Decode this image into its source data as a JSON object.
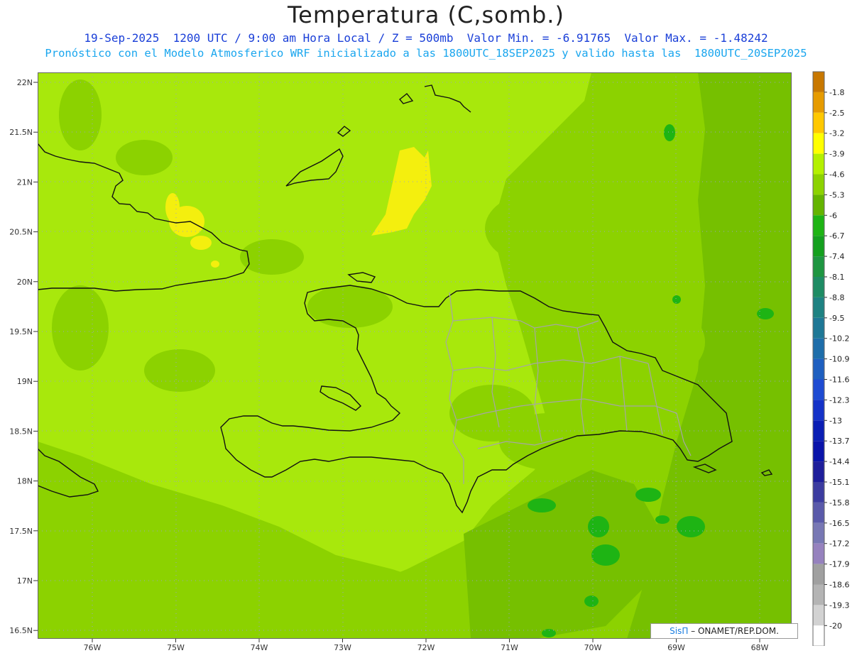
{
  "header": {
    "title": "Temperatura (C,somb.)",
    "line1": "19-Sep-2025  1200 UTC / 9:00 am Hora Local / Z = 500mb  Valor Min. = -6.91765  Valor Max. = -1.48242",
    "line2": "Pronóstico con el Modelo Atmosferico WRF inicializado a las 1800UTC_18SEP2025 y valido hasta las  1800UTC_20SEP2025"
  },
  "map": {
    "lat_labels": [
      "22N",
      "21.5N",
      "21N",
      "20.5N",
      "20N",
      "19.5N",
      "19N",
      "18.5N",
      "18N",
      "17.5N",
      "17N",
      "16.5N"
    ],
    "lon_labels": [
      "76W",
      "75W",
      "74W",
      "73W",
      "72W",
      "71W",
      "70W",
      "69W",
      "68W"
    ],
    "grid": true
  },
  "colorbar": {
    "labels": [
      "-1.8",
      "-2.5",
      "-3.2",
      "-3.9",
      "-4.6",
      "-5.3",
      "-6",
      "-6.7",
      "-7.4",
      "-8.1",
      "-8.8",
      "-9.5",
      "-10.2",
      "-10.9",
      "-11.6",
      "-12.3",
      "-13",
      "-13.7",
      "-14.4",
      "-15.1",
      "-15.8",
      "-16.5",
      "-17.2",
      "-17.9",
      "-18.6",
      "-19.3",
      "-20"
    ],
    "colors": [
      "#c87800",
      "#e69b00",
      "#ffc800",
      "#ffff00",
      "#b4f000",
      "#8cd200",
      "#64b400",
      "#1eb414",
      "#14a01e",
      "#1e9641",
      "#1e8c64",
      "#1e8282",
      "#1e7896",
      "#1e6eaa",
      "#1e5fc0",
      "#1e4bd2",
      "#1432c8",
      "#0a1eb4",
      "#0a14aa",
      "#1e1e9b",
      "#3c3ca0",
      "#5a5aaa",
      "#7878b4",
      "#9682be",
      "#a0a0a0",
      "#b4b4b4",
      "#d2d2d2",
      "#ffffff"
    ]
  },
  "credit": {
    "brand": "SisΠ",
    "text": "– ONAMET/REP.DOM."
  }
}
